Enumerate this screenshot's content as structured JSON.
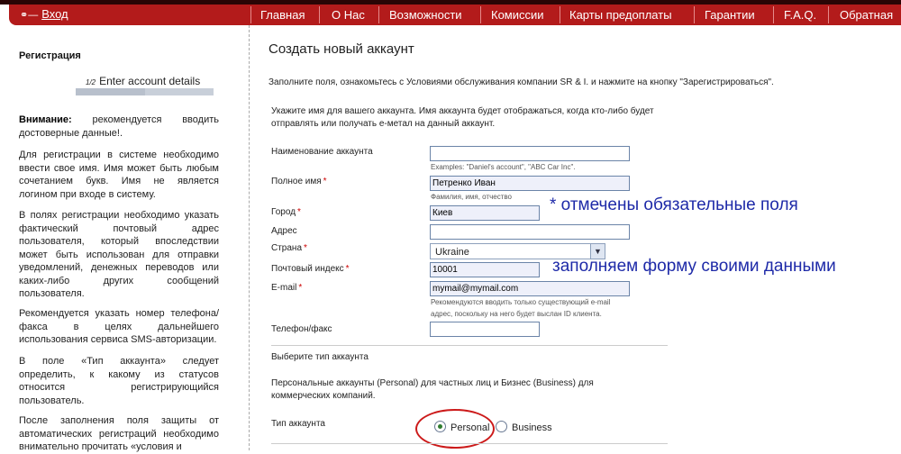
{
  "nav": {
    "login": "Вход",
    "items": [
      "Главная",
      "О Нас",
      "Возможности",
      "Комиссии",
      "Карты предоплаты",
      "Гарантии",
      "F.A.Q.",
      "Обратная"
    ]
  },
  "sidebar": {
    "title": "Регистрация",
    "step_fraction": "1/2",
    "step_label": "Enter account details",
    "step_progress": 0.5,
    "warning_bold": "Внимание:",
    "warning_text": " рекомендуется вводить достоверные данные!.",
    "p1": "Для регистрации в системе необходимо ввести свое имя. Имя может быть любым сочетанием букв. Имя не является логином при входе в систему.",
    "p2": "В полях регистрации необходимо указать фактический почтовый адрес пользователя, который впоследствии может быть использован для отправки уведомлений, денежных переводов или каких-либо других сообщений пользователя.",
    "p3": "Рекомендуется указать номер телефона/факса в целях дальнейшего использования сервиса SMS-авторизации.",
    "p4": "В поле «Тип аккаунта» следует определить, к какому из статусов относится регистрирующийся пользователь.",
    "p5": "После заполнения поля защиты от автоматических регистраций необходимо внимательно прочитать «условия и"
  },
  "main": {
    "title": "Создать новый аккаунт",
    "intro": "Заполните поля, ознакомьтесь с Условиями обслуживания компании SR & I. и нажмите на кнопку \"Зарегистрироваться\".",
    "desc": "Укажите имя для вашего аккаунта. Имя аккаунта будет отображаться, когда кто-либо будет отправлять или получать е-метал на данный аккаунт."
  },
  "form": {
    "account_name": {
      "label": "Наименование аккаунта",
      "value": "",
      "hint": "Examples: \"Daniel's account\", \"ABC Car Inc\"."
    },
    "full_name": {
      "label": "Полное имя",
      "value": "Петренко Иван",
      "hint": "Фамилия, имя, отчество"
    },
    "city": {
      "label": "Город",
      "value": "Киев"
    },
    "address": {
      "label": "Адрес",
      "value": ""
    },
    "country": {
      "label": "Страна",
      "value": "Ukraine"
    },
    "postal_code": {
      "label": "Почтовый индекс",
      "value": "10001"
    },
    "email": {
      "label": "E-mail",
      "value": "mymail@mymail.com",
      "hint1": "Рекомендуются вводить только существующий e-mail",
      "hint2": "адрес, поскольку на него будет выслан ID клиента."
    },
    "phone": {
      "label": "Телефон/факс",
      "value": ""
    },
    "required_mark": "*"
  },
  "annotations": {
    "required_note": "* отмечены обязательные поля",
    "fill_note": "заполняем форму своими данными"
  },
  "account_type": {
    "section_title": "Выберите тип аккаунта",
    "description": "Персональные аккаунты (Personal) для частных лиц и Бизнес (Business) для коммерческих компаний.",
    "label": "Тип аккаунта",
    "options": [
      "Personal",
      "Business"
    ],
    "selected": "Personal"
  }
}
